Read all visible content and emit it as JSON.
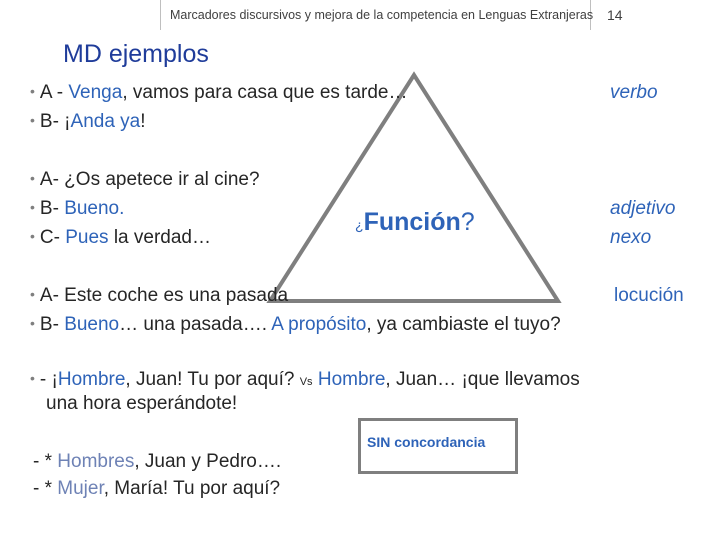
{
  "header": {
    "title": "Marcadores discursivos y mejora de la competencia en Lenguas Extranjeras",
    "page_number": "14"
  },
  "slide": {
    "title": "MD ejemplos"
  },
  "block1": {
    "line1": {
      "prefix": "A - ",
      "highlight": "Venga",
      "suffix": ", vamos para casa que es tarde…"
    },
    "line2": {
      "prefix": "B- ¡",
      "highlight": "Anda ya",
      "suffix": "!"
    }
  },
  "block2": {
    "line1": {
      "text": "A- ¿Os apetece ir al cine?"
    },
    "line2": {
      "prefix": "B- ",
      "highlight": "Bueno."
    },
    "line3": {
      "prefix": "C- ",
      "highlight": "Pues",
      "suffix": " la verdad…"
    }
  },
  "triangle": {
    "label_prefix": "¿",
    "label_bold": "Función",
    "label_suffix": "?"
  },
  "labels": {
    "verbo": "verbo",
    "adjetivo": "adjetivo",
    "nexo": "nexo",
    "locucion": "locución"
  },
  "block3": {
    "line1": {
      "text": "A- Este coche es una pasada"
    },
    "line2": {
      "prefix": "B- ",
      "h1": "Bueno",
      "mid": "… una pasada…. ",
      "h2": "A propósito",
      "suffix": ", ya cambiaste el tuyo?"
    }
  },
  "block4": {
    "line1": {
      "prefix": "- ¡",
      "h1": "Hombre",
      "mid": ", Juan! Tu por aquí? ",
      "vs": "Vs",
      "space": " ",
      "h2": "Hombre",
      "suffix": ", Juan… ¡que llevamos"
    },
    "line2": {
      "text": "una hora esperándote!"
    }
  },
  "block5": {
    "line1": {
      "prefix": "- * ",
      "highlight": "Hombres",
      "suffix": ", Juan y Pedro…."
    },
    "line2": {
      "prefix": "- * ",
      "highlight": "Mujer",
      "suffix": ", María! Tu por aquí?"
    }
  },
  "concordancia": {
    "label": "SIN concordancia"
  },
  "colors": {
    "accent_blue": "#2e63b8",
    "title_blue": "#1f3c9a",
    "gray_blue": "#6e82b5",
    "triangle_stroke": "#7f7f7f"
  }
}
